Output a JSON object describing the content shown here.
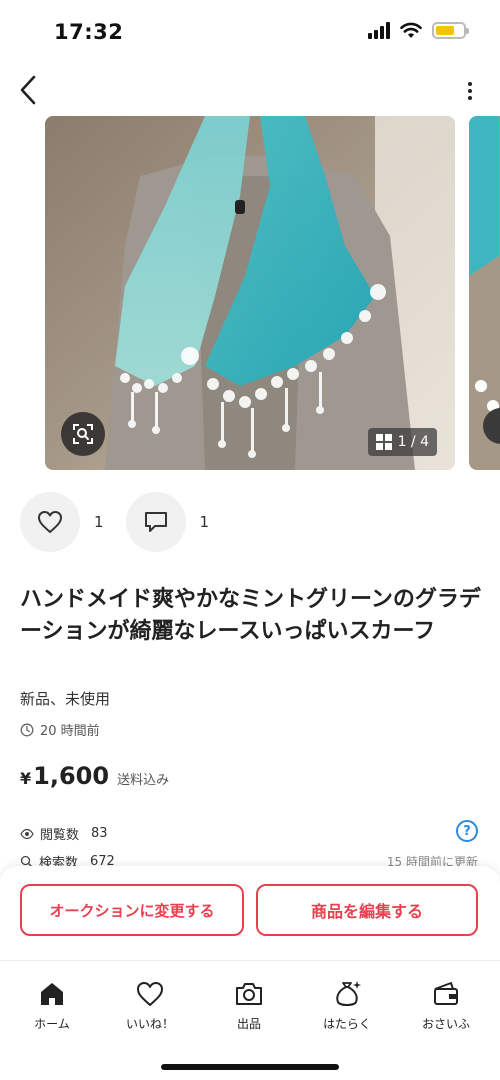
{
  "status_bar": {
    "time": "17:32"
  },
  "colors": {
    "accent": "#e8404f",
    "info": "#2b8be0",
    "battery": "#f5c400"
  },
  "product": {
    "image_counter": "1 / 4",
    "likes": "1",
    "comments": "1",
    "title": "ハンドメイド爽やかなミントグリーンのグラデーションが綺麗なレースいっぱいスカーフ",
    "condition": "新品、未使用",
    "posted": "20 時間前",
    "price_symbol": "¥",
    "price": "1,600",
    "shipping": "送料込み",
    "views_label": "閲覧数",
    "views": "83",
    "search_label": "検索数",
    "searches": "672",
    "updated": "15 時間前に更新",
    "help": "?"
  },
  "actions": {
    "auction": "オークションに変更する",
    "edit": "商品を編集する"
  },
  "tabs": [
    {
      "label": "ホーム",
      "icon": "home-icon"
    },
    {
      "label": "いいね！",
      "icon": "heart-icon"
    },
    {
      "label": "出品",
      "icon": "camera-icon"
    },
    {
      "label": "はたらく",
      "icon": "money-bag-icon"
    },
    {
      "label": "おさいふ",
      "icon": "wallet-icon"
    }
  ]
}
